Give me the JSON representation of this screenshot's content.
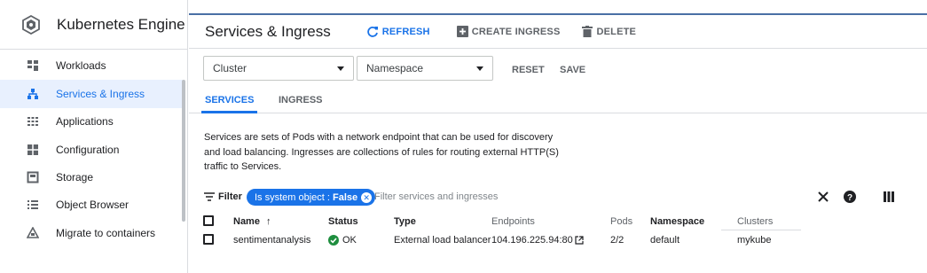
{
  "sidebar": {
    "title": "Kubernetes Engine",
    "items": [
      {
        "label": "Workloads",
        "icon": "workloads-icon"
      },
      {
        "label": "Services & Ingress",
        "icon": "services-icon",
        "active": true
      },
      {
        "label": "Applications",
        "icon": "applications-icon"
      },
      {
        "label": "Configuration",
        "icon": "configuration-icon"
      },
      {
        "label": "Storage",
        "icon": "storage-icon"
      },
      {
        "label": "Object Browser",
        "icon": "object-browser-icon"
      },
      {
        "label": "Migrate to containers",
        "icon": "migrate-icon"
      }
    ]
  },
  "header": {
    "title": "Services & Ingress",
    "refresh_label": "REFRESH",
    "create_label": "CREATE INGRESS",
    "delete_label": "DELETE"
  },
  "filters": {
    "cluster_value": "Cluster",
    "namespace_value": "Namespace",
    "reset_label": "RESET",
    "save_label": "SAVE"
  },
  "tabs": [
    {
      "label": "SERVICES",
      "active": true
    },
    {
      "label": "INGRESS"
    }
  ],
  "description": "Services are sets of Pods with a network endpoint that can be used for discovery and load balancing. Ingresses are collections of rules for routing external HTTP(S) traffic to Services.",
  "filterbar": {
    "label": "Filter",
    "chip_prefix": "Is system object :",
    "chip_value": "False",
    "placeholder": "Filter services and ingresses"
  },
  "table": {
    "columns": {
      "name": "Name",
      "status": "Status",
      "type": "Type",
      "endpoints": "Endpoints",
      "pods": "Pods",
      "namespace": "Namespace",
      "clusters": "Clusters"
    },
    "sort_arrow": "↑",
    "rows": [
      {
        "name": "sentimentanalysis",
        "status": "OK",
        "type": "External load balancer",
        "endpoints": "104.196.225.94:80",
        "pods": "2/2",
        "namespace": "default",
        "clusters": "mykube"
      }
    ]
  },
  "colors": {
    "accent": "#1a73e8",
    "ok_green": "#1e8e3e",
    "active_bg": "#e8f0fe"
  }
}
